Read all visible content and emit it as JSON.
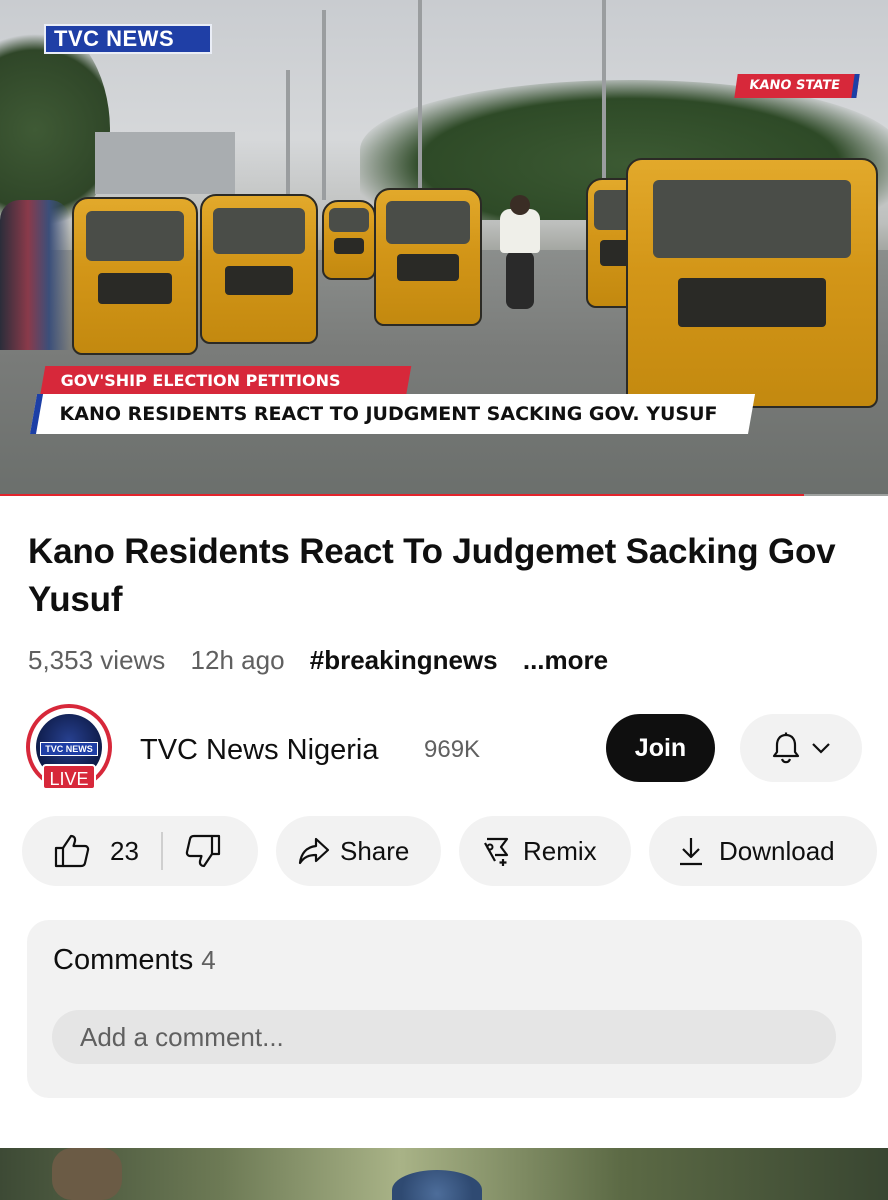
{
  "player": {
    "channel_logo_text": "TVC NEWS",
    "location_tag": "KANO STATE",
    "lower_third_kicker": "GOV'SHIP ELECTION PETITIONS",
    "lower_third_headline": "KANO RESIDENTS REACT TO JUDGMENT SACKING GOV. YUSUF",
    "progress_fraction": 0.905,
    "progress_color": "#e2242c"
  },
  "video": {
    "title": "Kano Residents React To Judgemet Sacking Gov  Yusuf",
    "views": "5,353 views",
    "age": "12h ago",
    "hashtag": "#breakingnews",
    "more_label": "...more"
  },
  "channel": {
    "avatar_logo_text": "TVC NEWS",
    "live_badge": "LIVE",
    "name": "TVC News Nigeria",
    "subscribers": "969K",
    "join_label": "Join",
    "bell_icon": "bell-icon",
    "dropdown_icon": "chevron-down-icon"
  },
  "actions": {
    "like_icon": "thumbs-up-icon",
    "like_count": "23",
    "dislike_icon": "thumbs-down-icon",
    "share_icon": "share-arrow-icon",
    "share_label": "Share",
    "remix_icon": "remix-icon",
    "remix_label": "Remix",
    "download_icon": "download-icon",
    "download_label": "Download"
  },
  "comments": {
    "label": "Comments",
    "count": "4",
    "placeholder": "Add a comment..."
  },
  "colors": {
    "accent_red": "#d7283a",
    "tvc_blue": "#1f3fa6",
    "pill_bg": "#f2f2f2",
    "join_bg": "#0f0f0f"
  }
}
